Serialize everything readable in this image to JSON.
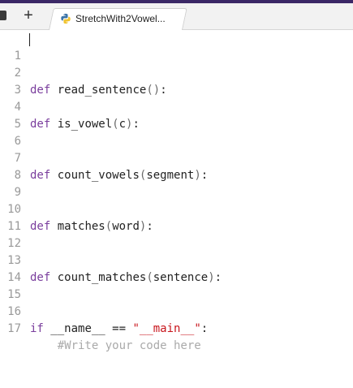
{
  "tabbar": {
    "add_label": "+",
    "tab_title": "StretchWith2Vowel..."
  },
  "editor": {
    "line_numbers": [
      "1",
      "2",
      "3",
      "4",
      "5",
      "6",
      "7",
      "8",
      "9",
      "10",
      "11",
      "12",
      "13",
      "14",
      "15",
      "16",
      "17"
    ],
    "lines": {
      "l1": {
        "kw": "def",
        "name": "read_sentence",
        "open": "(",
        "arg": "",
        "close": ")",
        "tail": ":"
      },
      "l4": {
        "kw": "def",
        "name": "is_vowel",
        "open": "(",
        "arg": "c",
        "close": ")",
        "tail": ":"
      },
      "l7": {
        "kw": "def",
        "name": "count_vowels",
        "open": "(",
        "arg": "segment",
        "close": ")",
        "tail": ":"
      },
      "l10": {
        "kw": "def",
        "name": "matches",
        "open": "(",
        "arg": "word",
        "close": ")",
        "tail": ":"
      },
      "l13": {
        "kw": "def",
        "name": "count_matches",
        "open": "(",
        "arg": "sentence",
        "close": ")",
        "tail": ":"
      },
      "l16": {
        "kw": "if",
        "name": "__name__",
        "op": "==",
        "str": "\"__main__\"",
        "tail": ":"
      },
      "l17": {
        "comment": "#Write your code here"
      }
    }
  }
}
